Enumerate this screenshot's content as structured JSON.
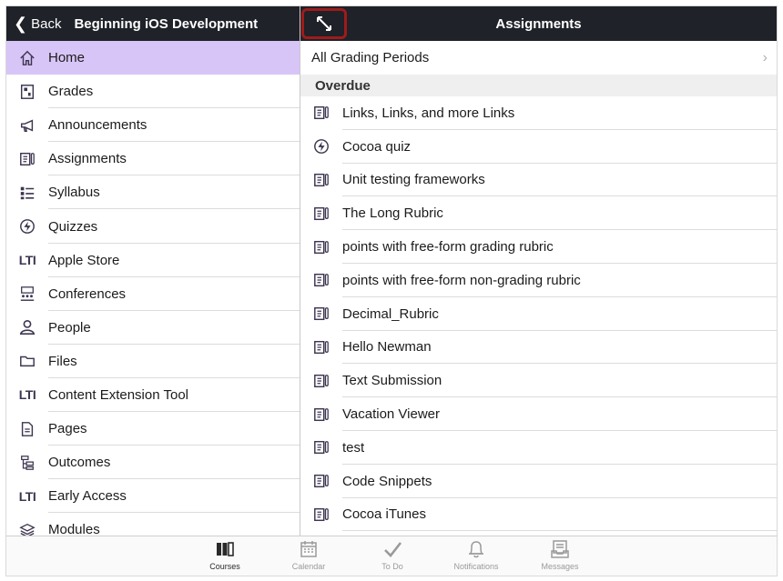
{
  "header": {
    "back_label": "Back",
    "course_title": "Beginning iOS Development",
    "right_title": "Assignments"
  },
  "sidebar": {
    "items": [
      {
        "label": "Home",
        "icon": "home-icon"
      },
      {
        "label": "Grades",
        "icon": "grades-icon"
      },
      {
        "label": "Announcements",
        "icon": "megaphone-icon"
      },
      {
        "label": "Assignments",
        "icon": "assignment-icon"
      },
      {
        "label": "Syllabus",
        "icon": "syllabus-icon"
      },
      {
        "label": "Quizzes",
        "icon": "quiz-icon"
      },
      {
        "label": "Apple Store",
        "icon": "lti-icon"
      },
      {
        "label": "Conferences",
        "icon": "conferences-icon"
      },
      {
        "label": "People",
        "icon": "person-icon"
      },
      {
        "label": "Files",
        "icon": "folder-icon"
      },
      {
        "label": "Content Extension Tool",
        "icon": "lti-icon"
      },
      {
        "label": "Pages",
        "icon": "page-icon"
      },
      {
        "label": "Outcomes",
        "icon": "outcomes-icon"
      },
      {
        "label": "Early Access",
        "icon": "lti-icon"
      },
      {
        "label": "Modules",
        "icon": "modules-icon"
      }
    ],
    "lti_text": "LTI",
    "selected_color": "#d8c5f7"
  },
  "content": {
    "grading_period": "All Grading Periods",
    "section_title": "Overdue",
    "assignments": [
      {
        "label": "Links, Links, and more Links",
        "icon": "assignment-icon"
      },
      {
        "label": "Cocoa quiz",
        "icon": "quiz-icon"
      },
      {
        "label": "Unit testing frameworks",
        "icon": "assignment-icon"
      },
      {
        "label": "The Long Rubric",
        "icon": "assignment-icon"
      },
      {
        "label": "points with free-form grading rubric",
        "icon": "assignment-icon"
      },
      {
        "label": "points with free-form non-grading rubric",
        "icon": "assignment-icon"
      },
      {
        "label": "Decimal_Rubric",
        "icon": "assignment-icon"
      },
      {
        "label": "Hello Newman",
        "icon": "assignment-icon"
      },
      {
        "label": "Text Submission",
        "icon": "assignment-icon"
      },
      {
        "label": "Vacation Viewer",
        "icon": "assignment-icon"
      },
      {
        "label": "test",
        "icon": "assignment-icon"
      },
      {
        "label": "Code Snippets",
        "icon": "assignment-icon"
      },
      {
        "label": "Cocoa iTunes",
        "icon": "assignment-icon"
      }
    ]
  },
  "tabbar": {
    "tabs": [
      {
        "label": "Courses",
        "icon": "courses-icon",
        "active": true
      },
      {
        "label": "Calendar",
        "icon": "calendar-icon",
        "active": false
      },
      {
        "label": "To Do",
        "icon": "checkmark-icon",
        "active": false
      },
      {
        "label": "Notifications",
        "icon": "bell-icon",
        "active": false
      },
      {
        "label": "Messages",
        "icon": "inbox-icon",
        "active": false
      }
    ]
  }
}
